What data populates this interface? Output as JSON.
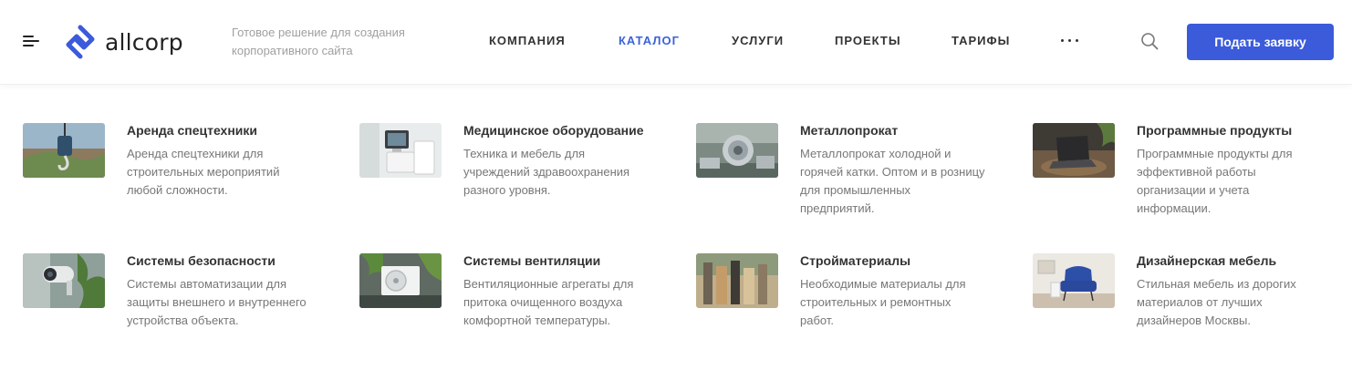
{
  "brand": {
    "name": "allcorp",
    "tagline": "Готовое решение для создания корпоративного сайта"
  },
  "nav": [
    {
      "label": "КОМПАНИЯ",
      "active": false
    },
    {
      "label": "КАТАЛОГ",
      "active": true
    },
    {
      "label": "УСЛУГИ",
      "active": false
    },
    {
      "label": "ПРОЕКТЫ",
      "active": false
    },
    {
      "label": "ТАРИФЫ",
      "active": false
    }
  ],
  "icons": {
    "menu": "hamburger-icon",
    "more": "more-dots-icon",
    "search": "search-icon",
    "logo": "allcorp-logo-icon"
  },
  "cta": {
    "label": "Подать заявку"
  },
  "colors": {
    "accent": "#3b5bdb",
    "active_nav": "#3b63d9",
    "text": "#333333",
    "muted": "#777777"
  },
  "catalog": [
    {
      "title": "Аренда спецтехники",
      "description": "Аренда спецтехники для строительных мероприятий любой сложности.",
      "image": "crane-hook"
    },
    {
      "title": "Медицинское оборудование",
      "description": "Техника и мебель для учреждений здравоохранения разного уровня.",
      "image": "medical-equipment"
    },
    {
      "title": "Металлопрокат",
      "description": "Металлопрокат холодной и горячей катки. Оптом и в розницу для промышленных предприятий.",
      "image": "steel-coil"
    },
    {
      "title": "Программные продукты",
      "description": "Программные продукты для эффективной работы организации и учета информации.",
      "image": "laptop"
    },
    {
      "title": "Системы безопасности",
      "description": "Системы автоматизации для защиты внешнего и внутреннего устройства объекта.",
      "image": "security-camera"
    },
    {
      "title": "Системы вентиляции",
      "description": "Вентиляционные агрегаты для притока очищенного воздуха комфортной температуры.",
      "image": "ventilation-unit"
    },
    {
      "title": "Стройматериалы",
      "description": "Необходимые материалы для строительных и ремонтных работ.",
      "image": "building-materials"
    },
    {
      "title": "Дизайнерская мебель",
      "description": "Стильная мебель из дорогих материалов от лучших дизайнеров Москвы.",
      "image": "armchair"
    }
  ]
}
